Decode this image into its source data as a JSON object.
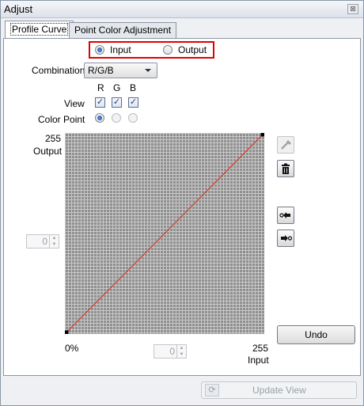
{
  "window": {
    "title": "Adjust",
    "close_glyph": "⊠"
  },
  "tabs": [
    {
      "label": "Profile Curve",
      "active": true
    },
    {
      "label": "Point Color Adjustment",
      "active": false
    }
  ],
  "mode": {
    "input_label": "Input",
    "output_label": "Output",
    "selected": "input"
  },
  "combination": {
    "label": "Combination",
    "value": "R/G/B"
  },
  "channels": {
    "headers": [
      "R",
      "G",
      "B"
    ],
    "view_label": "View",
    "view_checked": [
      true,
      true,
      true
    ],
    "color_point_label": "Color Point",
    "color_point_selected": 0
  },
  "curve": {
    "output_max_label": "255",
    "output_axis_label": "Output",
    "input_min_label": "0%",
    "input_max_label": "255",
    "input_axis_label": "Input",
    "output_spinner_value": "0",
    "input_spinner_value": "0",
    "points": [
      [
        0,
        0
      ],
      [
        255,
        255
      ]
    ],
    "line_color": "#d23b2c"
  },
  "tools": {
    "eyedropper_icon": "eyedropper-icon",
    "delete_icon": "trash-icon",
    "prev_point_icon": "arrow-left-point-icon",
    "next_point_icon": "arrow-right-point-icon"
  },
  "buttons": {
    "undo_label": "Undo",
    "update_view_label": "Update View"
  },
  "colors": {
    "highlight_border": "#e30000",
    "grid_background": "#8f8f8f"
  }
}
